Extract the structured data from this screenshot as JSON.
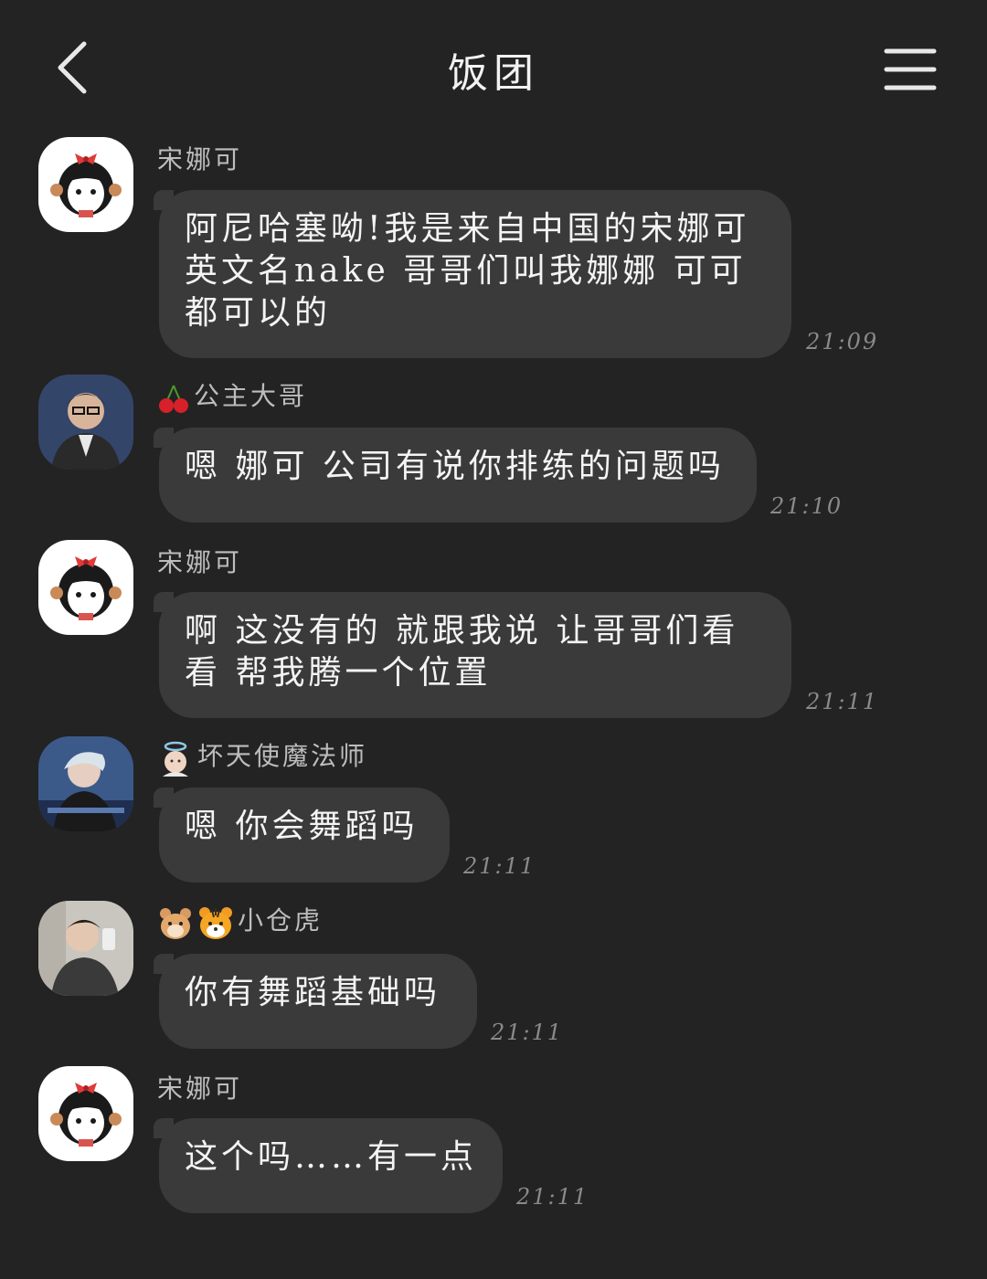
{
  "header": {
    "title": "饭团",
    "back_icon": "chevron-left-icon",
    "menu_icon": "hamburger-menu-icon"
  },
  "messages": [
    {
      "sender": "宋娜可",
      "text": "阿尼哈塞呦!我是来自中国的宋娜可 英文名nake 哥哥们叫我娜娜 可可都可以的",
      "time": "21:09"
    },
    {
      "sender": "公主大哥",
      "sender_emoji": "cherries",
      "text": "嗯 娜可 公司有说你排练的问题吗",
      "time": "21:10"
    },
    {
      "sender": "宋娜可",
      "text": "啊 这没有的 就跟我说 让哥哥们看看 帮我腾一个位置",
      "time": "21:11"
    },
    {
      "sender": "坏天使魔法师",
      "sender_emoji": "angel-face",
      "text": "嗯 你会舞蹈吗",
      "time": "21:11"
    },
    {
      "sender": "小仓虎",
      "sender_emoji": "hamster-face tiger-face",
      "text": "你有舞蹈基础吗",
      "time": "21:11"
    },
    {
      "sender": "宋娜可",
      "text": "这个吗……有一点",
      "time": "21:11"
    }
  ],
  "colors": {
    "background": "#232323",
    "bubble": "#3a3a3a",
    "text": "#f4f4f4",
    "sender": "#bdbdbd",
    "time": "#8a8a8a"
  }
}
